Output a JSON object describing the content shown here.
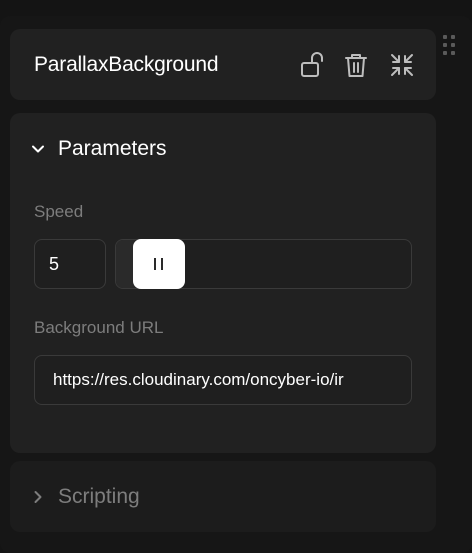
{
  "header": {
    "title": "ParallaxBackground",
    "icons": [
      "drag-handle-icon",
      "unlock-icon",
      "trash-icon",
      "collapse-arrows-icon"
    ]
  },
  "parameters": {
    "section_label": "Parameters",
    "expanded": true,
    "speed": {
      "label": "Speed",
      "value": "5",
      "slider_fraction": 0.07
    },
    "background_url": {
      "label": "Background URL",
      "value": "https://res.cloudinary.com/oncyber-io/ir"
    }
  },
  "scripting": {
    "section_label": "Scripting",
    "expanded": false
  },
  "colors": {
    "panel_bg": "#161616",
    "card_bg": "#212121",
    "text_primary": "#ffffff",
    "text_muted": "#7d7d7d",
    "border": "#3a3a3a"
  }
}
